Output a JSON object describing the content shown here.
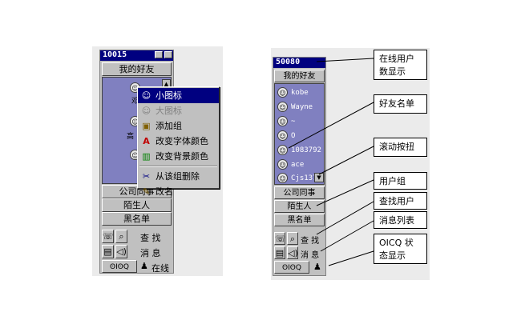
{
  "left_window": {
    "title": "10015",
    "header_group": "我的好友",
    "partial_names": [
      "邓",
      "高"
    ],
    "groups": [
      "公司同事",
      "陌生人",
      "黑名单"
    ],
    "tools": {
      "find": "查 找",
      "messages": "消 息",
      "status": "在线"
    },
    "context_menu": [
      {
        "label": "小图标",
        "icon": "person-icon",
        "state": "selected"
      },
      {
        "label": "大图标",
        "icon": "person-icon",
        "state": "disabled"
      },
      {
        "label": "添加组",
        "icon": "folder-icon",
        "state": "normal"
      },
      {
        "label": "改变字体颜色",
        "icon": "font-color-icon",
        "state": "normal"
      },
      {
        "label": "改变背景颜色",
        "icon": "bg-color-icon",
        "state": "normal"
      },
      {
        "label": "从该组删除",
        "icon": "delete-icon",
        "state": "normal"
      },
      {
        "label": "改名",
        "icon": "rename-icon",
        "state": "normal"
      }
    ]
  },
  "right_window": {
    "title": "50080",
    "header_group": "我的好友",
    "friends": [
      "kobe",
      "Wayne",
      "~",
      "O",
      "1083792",
      "ace",
      "Cjs137"
    ],
    "groups": [
      "公司同事",
      "陌生人",
      "黑名单"
    ],
    "tools": {
      "find": "查 找",
      "messages": "消 息"
    }
  },
  "callouts": {
    "online_count": "在线用户数显示",
    "friend_list": "好友名单",
    "scroll_button": "滚动按扭",
    "user_group": "用户组",
    "find_user": "查找用户",
    "message_list": "消息列表",
    "oicq_status": "OICQ 状态显示"
  },
  "colors": {
    "title_bar": "#000080",
    "list_bg": "#8080c0",
    "window": "#c0c0c0",
    "highlight": "#000080"
  }
}
